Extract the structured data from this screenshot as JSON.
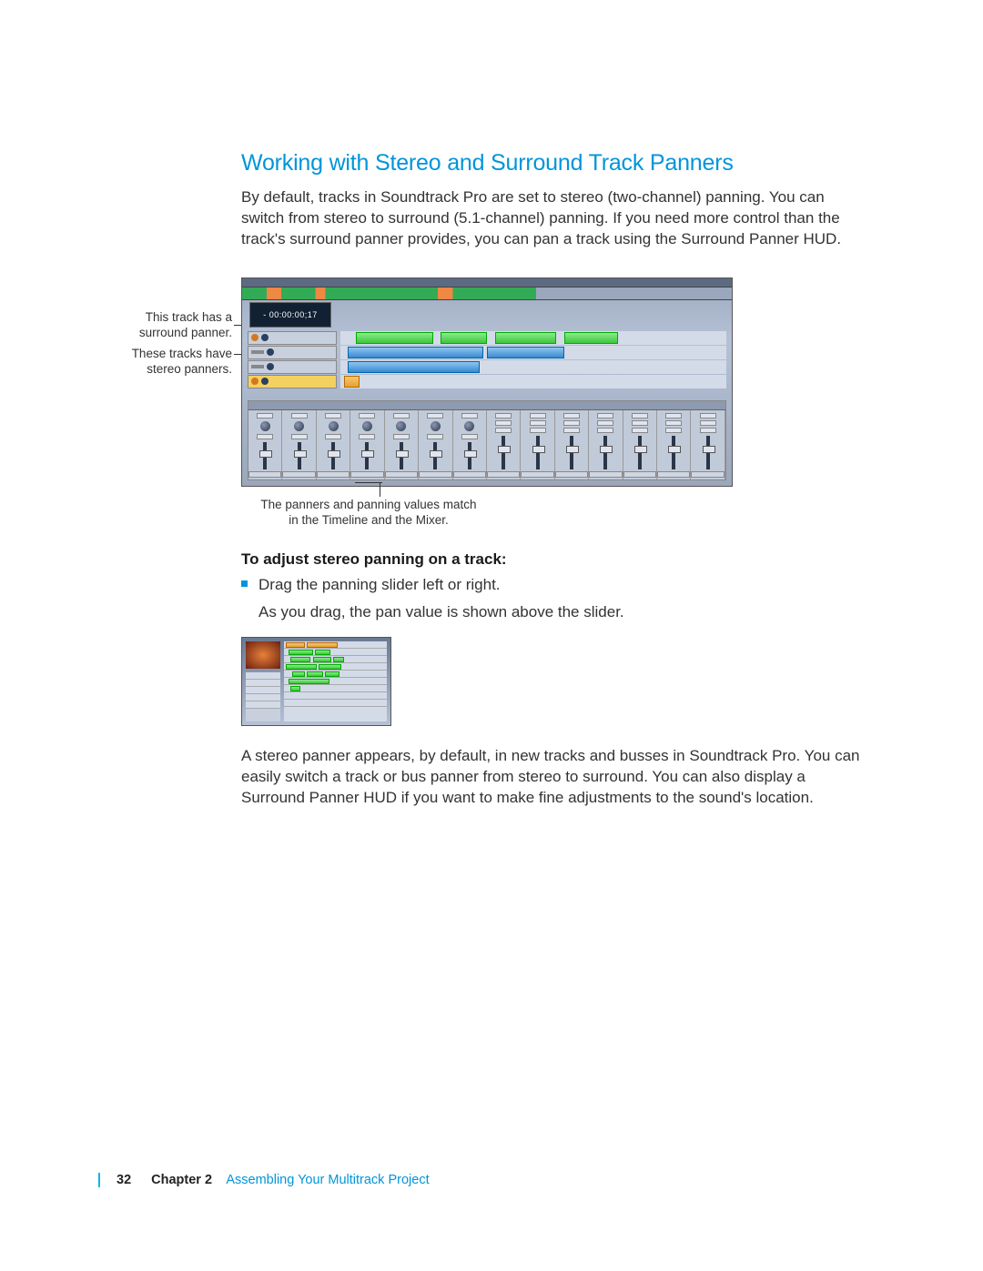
{
  "heading": "Working with Stereo and Surround Track Panners",
  "intro": "By default, tracks in Soundtrack Pro are set to stereo (two-channel) panning. You can switch from stereo to surround (5.1-channel) panning. If you need more control than the track's surround panner provides, you can pan a track using the Surround Panner HUD.",
  "callout_surround": "This track has a surround panner.",
  "callout_stereo": "These tracks have stereo panners.",
  "callout_bottom": "The panners and panning values match in the Timeline and the Mixer.",
  "timecode": "- 00:00:00;17",
  "sub_heading": "To adjust stereo panning on a track:",
  "bullet1": "Drag the panning slider left or right.",
  "bullet1_followup": "As you drag, the pan value is shown above the slider.",
  "para_after": "A stereo panner appears, by default, in new tracks and busses in Soundtrack Pro. You can easily switch a track or bus panner from stereo to surround. You can also display a Surround Panner HUD if you want to make fine adjustments to the sound's location.",
  "footer": {
    "page": "32",
    "chapter_label": "Chapter 2",
    "chapter_title": "Assembling Your Multitrack Project"
  }
}
